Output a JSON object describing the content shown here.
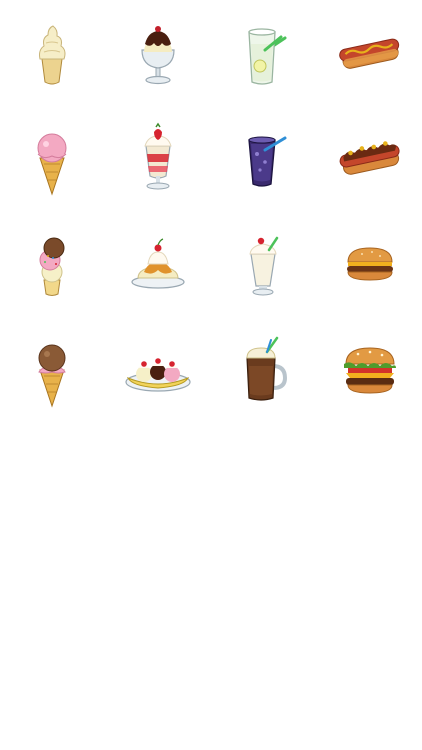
{
  "stickers": [
    {
      "name": "soft-serve-cone",
      "icon": "soft-serve-cone-icon"
    },
    {
      "name": "chocolate-sundae",
      "icon": "chocolate-sundae-icon"
    },
    {
      "name": "lemonade-glass",
      "icon": "lemonade-glass-icon"
    },
    {
      "name": "hot-dog",
      "icon": "hot-dog-icon"
    },
    {
      "name": "strawberry-cone",
      "icon": "strawberry-cone-icon"
    },
    {
      "name": "strawberry-parfait",
      "icon": "strawberry-parfait-icon"
    },
    {
      "name": "grape-soda",
      "icon": "grape-soda-icon"
    },
    {
      "name": "chili-dog",
      "icon": "chili-dog-icon"
    },
    {
      "name": "triple-scoop-cone",
      "icon": "triple-scoop-cone-icon"
    },
    {
      "name": "caramel-sundae",
      "icon": "caramel-sundae-icon"
    },
    {
      "name": "vanilla-milkshake",
      "icon": "vanilla-milkshake-icon"
    },
    {
      "name": "hamburger",
      "icon": "hamburger-icon"
    },
    {
      "name": "chocolate-cone",
      "icon": "chocolate-cone-icon"
    },
    {
      "name": "banana-split",
      "icon": "banana-split-icon"
    },
    {
      "name": "root-beer-float",
      "icon": "root-beer-float-icon"
    },
    {
      "name": "deluxe-burger",
      "icon": "deluxe-burger-icon"
    }
  ],
  "colors": {
    "background": "#ffffff",
    "cone": "#e8b24a",
    "vanilla": "#f5ecc2",
    "chocolate": "#5a2a16",
    "strawberry": "#f3a9c2",
    "cherry": "#d6232f",
    "bun": "#d9883b",
    "sausage": "#c4462b",
    "mustard": "#e7b21b",
    "ketchup": "#d2342a",
    "grape": "#3a2a6e",
    "straw_blue": "#2f8fd6",
    "straw_green": "#4cc25a",
    "lettuce": "#4f9c2c",
    "cheese": "#f2b01e"
  }
}
